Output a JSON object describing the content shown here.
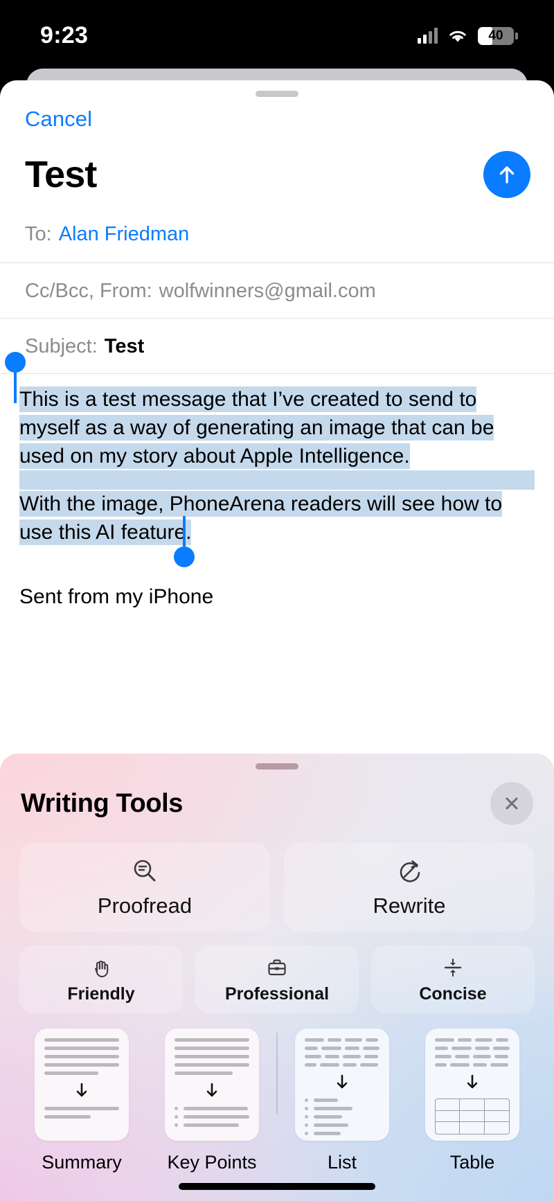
{
  "status_bar": {
    "time": "9:23",
    "battery_percent": "40",
    "signal_icon": "cellular-signal-icon",
    "wifi_icon": "wifi-icon",
    "battery_icon": "battery-icon"
  },
  "compose": {
    "cancel_label": "Cancel",
    "title": "Test",
    "send_icon": "arrow-up-icon",
    "to_label": "To:",
    "to_value": "Alan Friedman",
    "cc_label": "Cc/Bcc, From:",
    "cc_value": "wolfwinners@gmail.com",
    "subject_label": "Subject:",
    "subject_value": "Test",
    "body_paragraph_1": "This is a test message that I’ve created to send to myself as a way of generating an image that can be used on my story about Apple Intelligence.",
    "body_paragraph_2": "With the image, PhoneArena readers will see how to use this AI feature.",
    "signature": "Sent from my iPhone"
  },
  "writing_tools": {
    "title": "Writing Tools",
    "close_icon": "close-icon",
    "primary_actions": [
      {
        "label": "Proofread",
        "icon": "magnifier-lines-icon"
      },
      {
        "label": "Rewrite",
        "icon": "circular-arrow-pencil-icon"
      }
    ],
    "tone_actions": [
      {
        "label": "Friendly",
        "icon": "waving-hand-icon"
      },
      {
        "label": "Professional",
        "icon": "briefcase-icon"
      },
      {
        "label": "Concise",
        "icon": "compress-arrows-icon"
      }
    ],
    "transform_actions": [
      {
        "label": "Summary",
        "icon": "document-summary-icon"
      },
      {
        "label": "Key Points",
        "icon": "document-key-points-icon"
      },
      {
        "label": "List",
        "icon": "document-list-icon"
      },
      {
        "label": "Table",
        "icon": "document-table-icon"
      }
    ]
  },
  "colors": {
    "accent_blue": "#0a7cff",
    "selection_highlight": "#c5d9ec",
    "panel_pink": "#f7dde4",
    "panel_blue": "#d4e2f4"
  }
}
